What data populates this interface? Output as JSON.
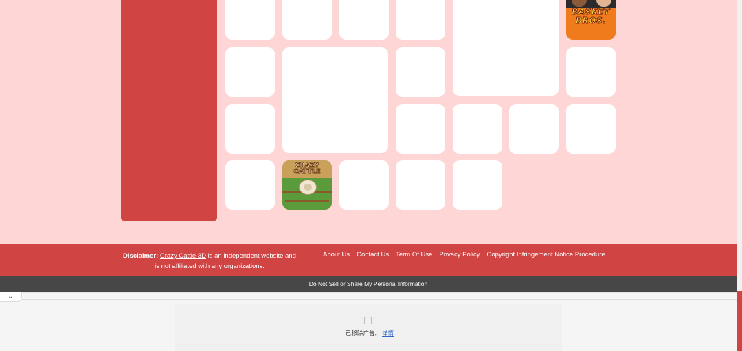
{
  "grid": {
    "games": [
      {
        "name": "Basket Bros",
        "logo_line1": "BASKET",
        "logo_line2": "BROS."
      },
      {
        "name": "Crazy Cattle",
        "logo": "CRAZY CATTLE"
      }
    ]
  },
  "footer": {
    "disclaimer_label": "Disclaimer:",
    "disclaimer_link": "Crazy Cattle 3D",
    "disclaimer_text1": " is an independent website and",
    "disclaimer_text2": "is not affiliated with any organizations.",
    "links": [
      "About Us",
      "Contact Us",
      "Term Of Use",
      "Privacy Policy",
      "Copyright Infringement Notice Procedure"
    ]
  },
  "privacy_bar": {
    "label": "Do Not Sell or Share My Personal Information"
  },
  "ad_notice": {
    "text": "已移除广告。",
    "detail_link": "详情"
  },
  "colors": {
    "accent": "#d14444",
    "background": "#ffd6d6",
    "bar": "#474747"
  }
}
